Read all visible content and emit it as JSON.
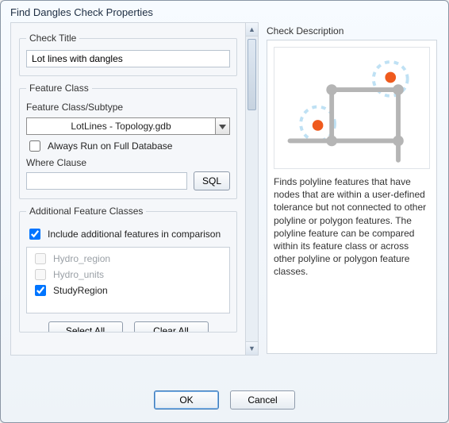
{
  "window": {
    "title": "Find Dangles Check Properties"
  },
  "checkTitle": {
    "legend": "Check Title",
    "value": "Lot lines with dangles"
  },
  "featureClass": {
    "legend": "Feature Class",
    "subtypeLabel": "Feature Class/Subtype",
    "comboValue": "LotLines - Topology.gdb",
    "alwaysRunLabel": "Always Run on Full Database",
    "alwaysRunChecked": false,
    "whereLabel": "Where Clause",
    "whereValue": "",
    "sqlLabel": "SQL"
  },
  "additional": {
    "legend": "Additional Feature Classes",
    "includeLabel": "Include additional features in comparison",
    "includeChecked": true,
    "items": [
      {
        "label": "Hydro_region",
        "checked": false,
        "disabled": true
      },
      {
        "label": "Hydro_units",
        "checked": false,
        "disabled": true
      },
      {
        "label": "StudyRegion",
        "checked": true,
        "disabled": false
      }
    ],
    "selectAll": "Select All",
    "clearAll": "Clear All"
  },
  "description": {
    "legend": "Check Description",
    "text": "Finds polyline features that have nodes that are within a user-defined tolerance but not connected to other polyline or polygon features.  The polyline feature can be compared within its feature class or across other polyline or polygon feature classes."
  },
  "footer": {
    "ok": "OK",
    "cancel": "Cancel"
  }
}
